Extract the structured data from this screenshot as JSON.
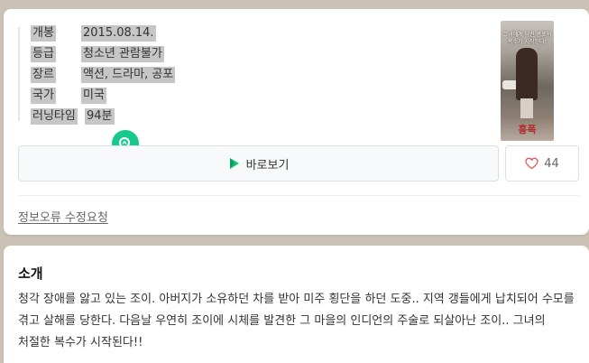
{
  "movie_info": {
    "rows": [
      {
        "key": "개봉",
        "value": "2015.08.14."
      },
      {
        "key": "등급",
        "value": "청소년 관람불가"
      },
      {
        "key": "장르",
        "value": "액션, 드라마, 공포"
      },
      {
        "key": "국가",
        "value": "미국"
      },
      {
        "key": "러닝타임",
        "value": "94분"
      }
    ],
    "poster": {
      "tagline": "그녀에게 닥친 공포의 복수가 시작된다!",
      "title": "흉폭"
    },
    "watch_label": "바로보기",
    "like_count": "44",
    "report_label": "정보오류 수정요청"
  },
  "intro": {
    "title": "소개",
    "body": "청각 장애를 앓고 있는 조이. 아버지가 소유하던 차를 받아 미주 횡단을 하던 도중.. 지역 갱들에게 납치되어 수모를 겪고 살해를 당한다. 다음날 우연히 조이에 시체를 발견한 그 마을의 인디언의 주술로 되살아난 조이.. 그녀의 처절한 복수가 시작된다!!"
  },
  "colors": {
    "background": "#c9c2b5",
    "accent_green": "#17c98c",
    "heart": "#e45757"
  },
  "icons": {
    "lens": "lens-search-icon",
    "play": "play-logo-icon",
    "heart": "heart-outline-icon"
  }
}
